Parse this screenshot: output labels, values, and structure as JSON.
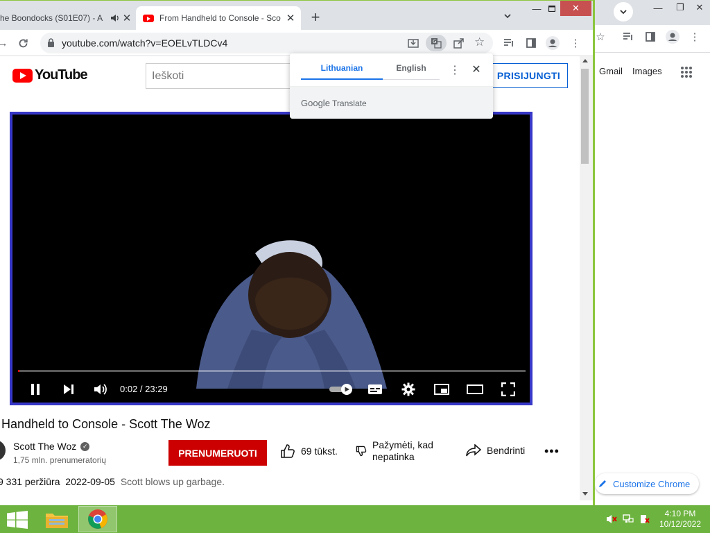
{
  "tabs": [
    {
      "title": "he Boondocks (S01E07) - A",
      "audio": true
    },
    {
      "title": "From Handheld to Console - Sco",
      "active": true
    }
  ],
  "toolbar": {
    "url": "youtube.com/watch?v=EOELvTLDCv4"
  },
  "youtube": {
    "logo_text": "YouTube",
    "search_placeholder": "Ieškoti",
    "signin_label": "PRISIJUNGTI"
  },
  "player": {
    "time": "0:02 / 23:29",
    "progress": 0.0014
  },
  "video": {
    "title": "m Handheld to Console - Scott The Woz",
    "channel": "Scott The Woz",
    "subscribers": "1,75 mln. prenumeratorių",
    "subscribe_label": "PRENUMERUOTI",
    "likes": "69 tūkst.",
    "dislike_label_1": "Pažymėti, kad",
    "dislike_label_2": "nepatinka",
    "share_label": "Bendrinti",
    "views": "9 331 peržiūra",
    "date": "2022-09-05",
    "description": "Scott blows up garbage."
  },
  "translate": {
    "source_lang": "Lithuanian",
    "target_lang": "English",
    "brand_google": "Google",
    "brand_translate": "Translate"
  },
  "bg_window": {
    "gmail": "Gmail",
    "images": "Images",
    "customize": "Customize Chrome"
  },
  "taskbar": {
    "time": "4:10 PM",
    "date": "10/12/2022"
  },
  "colors": {
    "taskbar": "#6db33f",
    "subscribe": "#cc0000",
    "accent": "#1a73e8",
    "youtube_red": "#ff0000"
  }
}
